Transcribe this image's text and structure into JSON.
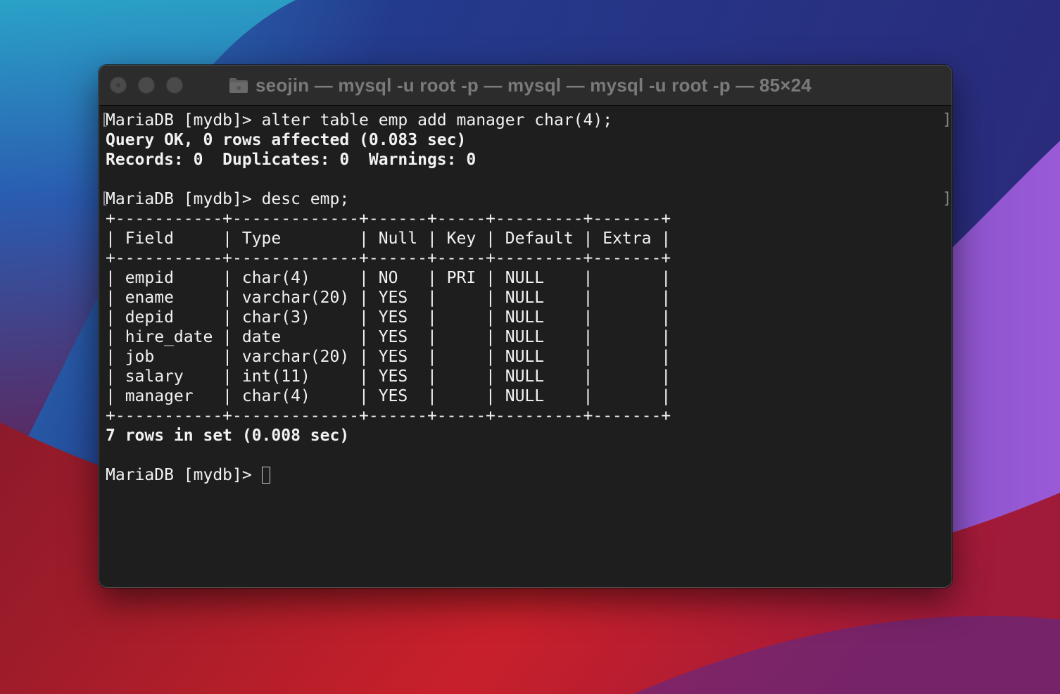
{
  "window": {
    "title": "seojin — mysql -u root -p — mysql — mysql -u root -p — 85×24",
    "folder_icon": "folder-icon"
  },
  "colors": {
    "terminal_bg": "#1e1e1e",
    "terminal_text": "#f2f2f2",
    "titlebar_bg": "#2c2c2c",
    "title_text": "#7a7a7a"
  },
  "terminal": {
    "mark_left": "[",
    "mark_right": "]",
    "prompt": "MariaDB [mydb]> ",
    "cmd1": "alter table emp add manager char(4);",
    "result1_line1": "Query OK, 0 rows affected (0.083 sec)",
    "result1_line2": "Records: 0  Duplicates: 0  Warnings: 0",
    "cmd2": "desc emp;",
    "table_border": "+-----------+-------------+------+-----+---------+-------+",
    "table_header": "| Field     | Type        | Null | Key | Default | Extra |",
    "table_rows": [
      "| empid     | char(4)     | NO   | PRI | NULL    |       |",
      "| ename     | varchar(20) | YES  |     | NULL    |       |",
      "| depid     | char(3)     | YES  |     | NULL    |       |",
      "| hire_date | date        | YES  |     | NULL    |       |",
      "| job       | varchar(20) | YES  |     | NULL    |       |",
      "| salary    | int(11)     | YES  |     | NULL    |       |",
      "| manager   | char(4)     | YES  |     | NULL    |       |"
    ],
    "result2": "7 rows in set (0.008 sec)",
    "final_prompt": "MariaDB [mydb]> "
  }
}
